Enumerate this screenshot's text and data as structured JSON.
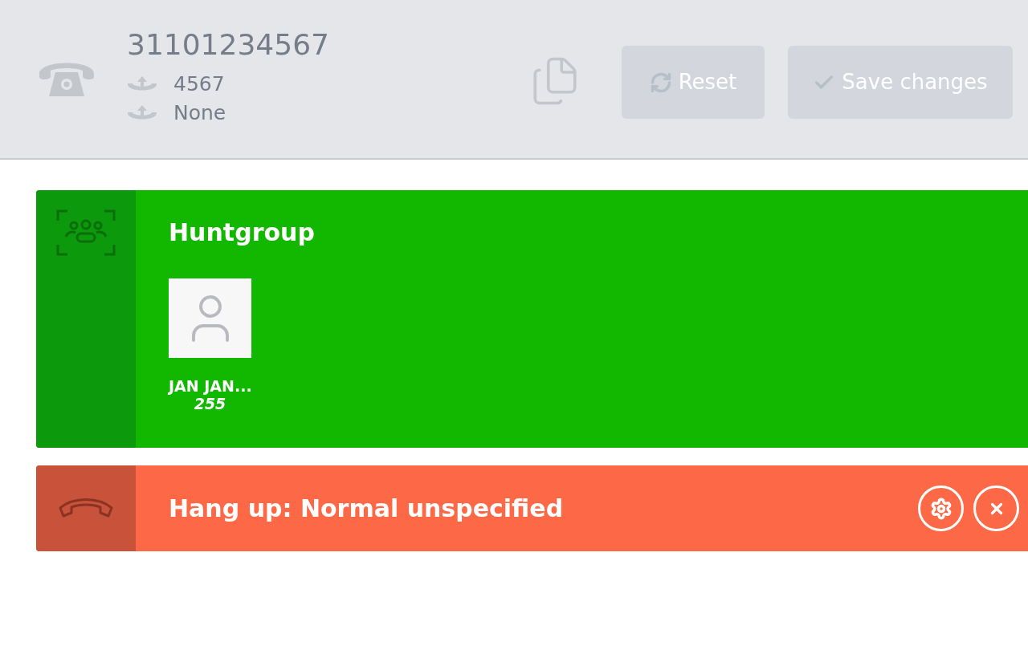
{
  "header": {
    "number": "31101234567",
    "lines": [
      {
        "text": "4567"
      },
      {
        "text": "None"
      }
    ],
    "buttons": [
      {
        "kind": "reset",
        "label": "Reset",
        "disabled": true
      },
      {
        "kind": "save",
        "label": "Save changes",
        "disabled": true
      }
    ]
  },
  "blocks": [
    {
      "kind": "huntgroup",
      "title": "Huntgroup",
      "members": [
        {
          "name": "JAN JAN...",
          "extension": "255"
        }
      ]
    },
    {
      "kind": "hangup",
      "title": "Hang up: Normal unspecified"
    }
  ]
}
